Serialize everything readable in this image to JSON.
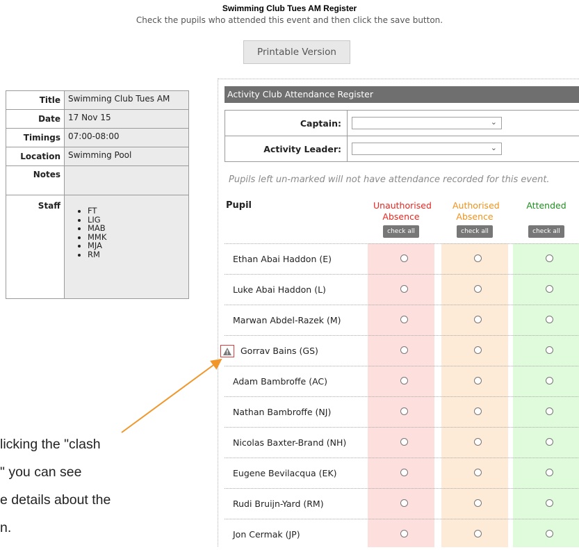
{
  "header": {
    "title": "Swimming Club Tues AM Register",
    "subtitle": "Check the pupils who attended this event and then click the save button.",
    "print_label": "Printable Version"
  },
  "details": {
    "title_label": "Title",
    "title_value": "Swimming Club Tues AM",
    "date_label": "Date",
    "date_value": "17 Nov 15",
    "timings_label": "Timings",
    "timings_value": "07:00-08:00",
    "location_label": "Location",
    "location_value": "Swimming Pool",
    "notes_label": "Notes",
    "notes_value": "",
    "staff_label": "Staff",
    "staff": [
      "FT",
      "LIG",
      "MAB",
      "MMK",
      "MJA",
      "RM"
    ]
  },
  "register": {
    "header": "Activity Club Attendance Register",
    "captain_label": "Captain:",
    "leader_label": "Activity Leader:",
    "hint": "Pupils left un-marked will not have attendance recorded for this event.",
    "pupil_col": "Pupil",
    "columns": [
      {
        "label": "Unauthorised Absence",
        "color": "#e8261f",
        "bg": "#fde0de"
      },
      {
        "label": "Authorised Absence",
        "color": "#f0911a",
        "bg": "#fdebd7"
      },
      {
        "label": "Attended",
        "color": "#1e8f1e",
        "bg": "#dffbdc"
      }
    ],
    "check_all": "check all",
    "pupils": [
      "Ethan Abai Haddon (E)",
      "Luke Abai Haddon (L)",
      "Marwan Abdel-Razek (M)",
      "Gorrav Bains (GS)",
      "Adam Bambroffe (AC)",
      "Nathan Bambroffe (NJ)",
      "Nicolas Baxter-Brand (NH)",
      "Eugene Bevilacqua (EK)",
      "Rudi Bruijn-Yard (RM)",
      "Jon Cermak (JP)"
    ]
  },
  "annotation": {
    "lines": [
      "licking the \"clash",
      "\" you can see",
      "e details about the",
      "n."
    ],
    "arrow_color": "#f0962b"
  },
  "colors": {
    "clash_border": "#e23b3b",
    "clash_icon": "#777777"
  }
}
